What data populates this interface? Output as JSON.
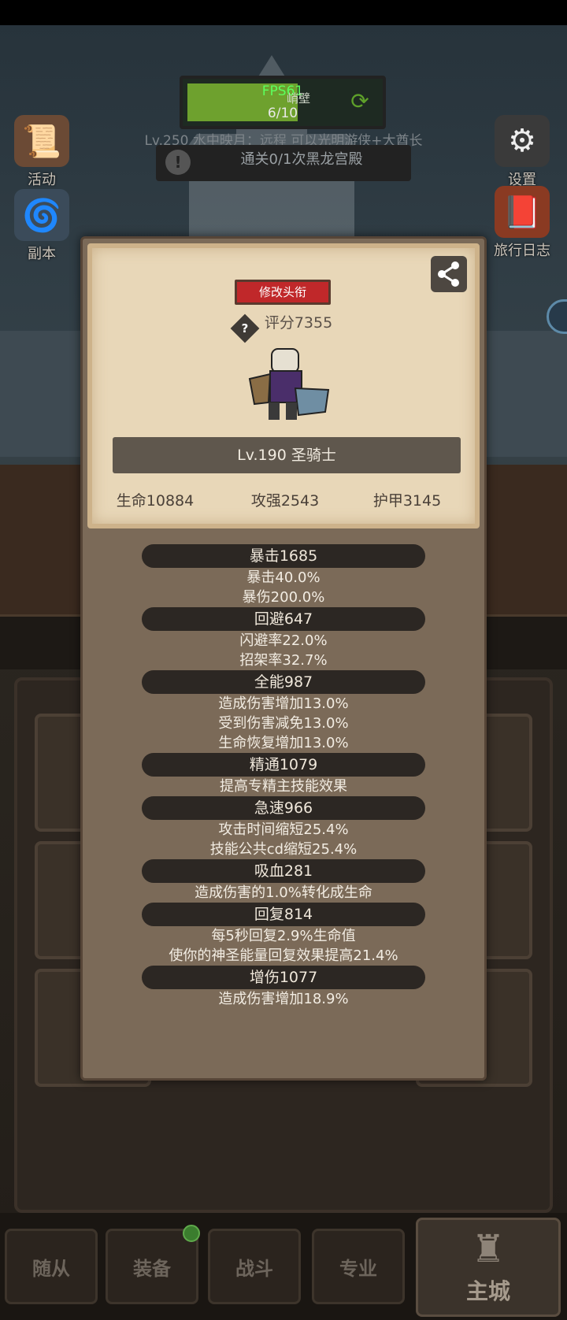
{
  "hud": {
    "fps": "FPS61",
    "quest_name": "峭壁",
    "quest_count": "6/10",
    "level_hint": "Lv.250 水中映月：远程 可以光明游侠+大酋长",
    "clear_text": "通关0/1次黑龙宫殿"
  },
  "side_buttons": {
    "activity": "活动",
    "dungeon": "副本",
    "settings": "设置",
    "travel_log": "旅行日志"
  },
  "profile": {
    "title_button": "修改头衔",
    "score": "评分7355",
    "level_class": "Lv.190 圣骑士",
    "hp": "生命10884",
    "attack": "攻强2543",
    "armor": "护甲3145"
  },
  "stats": [
    {
      "head": "暴击1685",
      "lines": [
        "暴击40.0%",
        "暴伤200.0%"
      ]
    },
    {
      "head": "回避647",
      "lines": [
        "闪避率22.0%",
        "招架率32.7%"
      ]
    },
    {
      "head": "全能987",
      "lines": [
        "造成伤害增加13.0%",
        "受到伤害减免13.0%",
        "生命恢复增加13.0%"
      ]
    },
    {
      "head": "精通1079",
      "lines": [
        "提高专精主技能效果"
      ]
    },
    {
      "head": "急速966",
      "lines": [
        "攻击时间缩短25.4%",
        "技能公共cd缩短25.4%"
      ]
    },
    {
      "head": "吸血281",
      "lines": [
        "造成伤害的1.0%转化成生命"
      ]
    },
    {
      "head": "回复814",
      "lines": [
        "每5秒回复2.9%生命值",
        "使你的神圣能量回复效果提高21.4%"
      ]
    },
    {
      "head": "增伤1077",
      "lines": [
        "造成伤害增加18.9%"
      ]
    }
  ],
  "nav": {
    "followers": "随从",
    "equipment": "装备",
    "battle": "战斗",
    "profession": "专业",
    "main_city": "主城"
  },
  "icons": {
    "activity": "scroll-icon",
    "dungeon": "portal-icon",
    "settings": "gear-icon",
    "travel_log": "book-icon",
    "share": "share-icon",
    "help": "question-icon",
    "refresh": "refresh-icon",
    "castle": "castle-icon"
  },
  "colors": {
    "title_button": "#c0282a",
    "fps": "#5dff5d",
    "quest_fill": "#6ea12e",
    "card_bg": "#e8d7b8",
    "panel_bg": "#7b6a58"
  }
}
